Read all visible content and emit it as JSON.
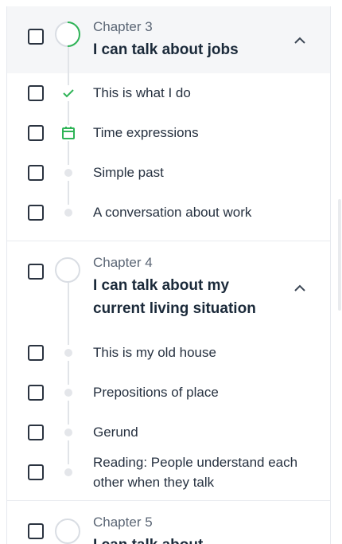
{
  "chapters": [
    {
      "label": "Chapter 3",
      "title": "I can talk about jobs",
      "progress": 0.33
    },
    {
      "label": "Chapter 4",
      "title": "I can talk about my current living situation",
      "progress": 0
    },
    {
      "label": "Chapter 5",
      "title": "I can talk about",
      "progress": 0
    }
  ],
  "lessons_ch3": [
    {
      "label": "This is what I do",
      "status": "completed",
      "icon": "check-icon"
    },
    {
      "label": "Time expressions",
      "status": "current",
      "icon": "calendar-icon"
    },
    {
      "label": "Simple past",
      "status": "pending",
      "icon": "dot"
    },
    {
      "label": "A conversation about work",
      "status": "pending",
      "icon": "dot"
    }
  ],
  "lessons_ch4": [
    {
      "label": "This is my old house",
      "status": "pending",
      "icon": "dot"
    },
    {
      "label": "Prepositions of place",
      "status": "pending",
      "icon": "dot"
    },
    {
      "label": "Gerund",
      "status": "pending",
      "icon": "dot"
    },
    {
      "label": "Reading: People understand each other when they talk",
      "status": "pending",
      "icon": "dot"
    }
  ],
  "colors": {
    "accent_green": "#2fb457",
    "header_bg": "#f5f6f8",
    "text_dark": "#1b2a3a"
  }
}
